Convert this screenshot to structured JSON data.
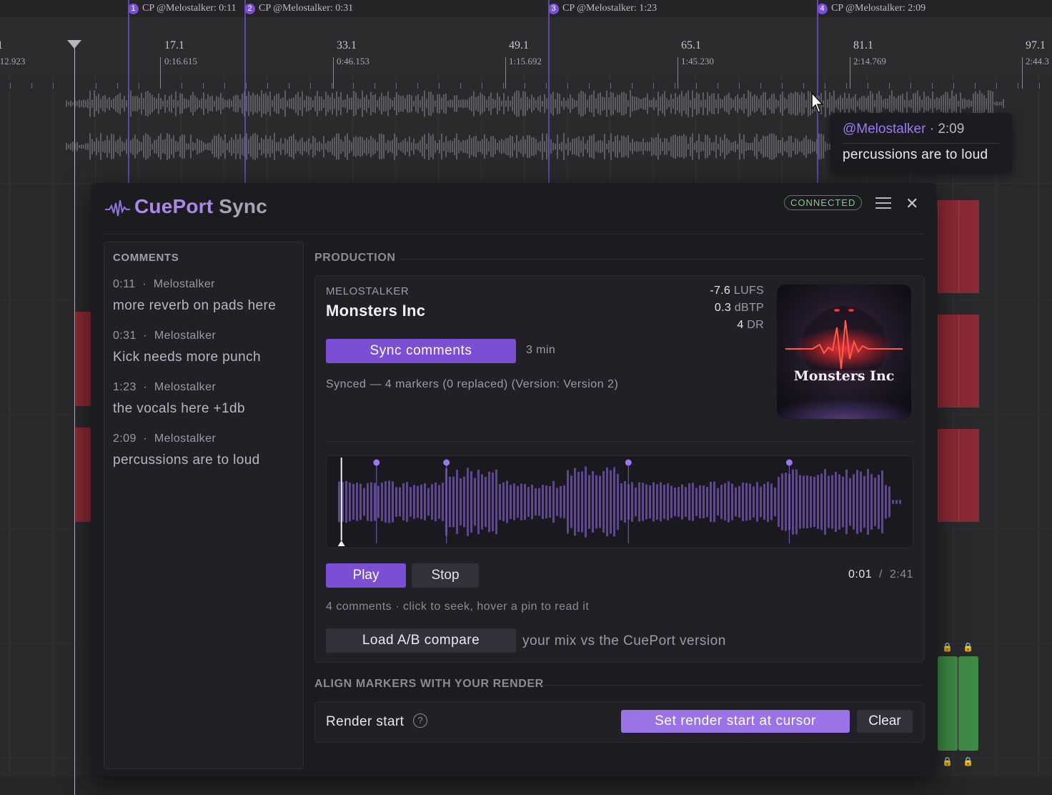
{
  "timeline": {
    "markers": [
      {
        "num": "1",
        "label": "CP @Melostalker: 0:11"
      },
      {
        "num": "2",
        "label": "CP @Melostalker: 0:31"
      },
      {
        "num": "3",
        "label": "CP @Melostalker: 1:23"
      },
      {
        "num": "4",
        "label": "CP @Melostalker: 2:09"
      }
    ],
    "ruler": [
      {
        "bar": "1",
        "time": ":12.923"
      },
      {
        "bar": "17.1",
        "time": "0:16.615"
      },
      {
        "bar": "33.1",
        "time": "0:46.153"
      },
      {
        "bar": "49.1",
        "time": "1:15.692"
      },
      {
        "bar": "65.1",
        "time": "1:45.230"
      },
      {
        "bar": "81.1",
        "time": "2:14.769"
      },
      {
        "bar": "97.1",
        "time": "2:44.3"
      }
    ]
  },
  "tooltip": {
    "user": "@Melostalker",
    "time": "· 2:09",
    "text": "percussions are to loud"
  },
  "plugin": {
    "title_part1": "CuePort",
    "title_part2": "Sync",
    "status": "CONNECTED",
    "accent_color": "#7b4fd4",
    "icons": {
      "menu": "hamburger-menu-icon",
      "close": "close-icon",
      "help": "help-circle-icon",
      "logo": "waveform-logo-icon"
    }
  },
  "comments": {
    "title": "COMMENTS",
    "items": [
      {
        "time": "0:11",
        "sep": "·",
        "author": "Melostalker",
        "text": "more reverb on pads here"
      },
      {
        "time": "0:31",
        "sep": "·",
        "author": "Melostalker",
        "text": "Kick needs more punch"
      },
      {
        "time": "1:23",
        "sep": "·",
        "author": "Melostalker",
        "text": "the vocals here +1db"
      },
      {
        "time": "2:09",
        "sep": "·",
        "author": "Melostalker",
        "text": "percussions are to loud"
      }
    ]
  },
  "production": {
    "section_label": "PRODUCTION",
    "artist": "MELOSTALKER",
    "song": "Monsters Inc",
    "stats": [
      {
        "value": "-7.6",
        "unit": "LUFS"
      },
      {
        "value": "0.3",
        "unit": "dBTP"
      },
      {
        "value": "4",
        "unit": "DR"
      }
    ],
    "album_art_text": "Monsters Inc",
    "sync_button": "Sync comments",
    "sync_age": "3 min",
    "sync_status": "Synced — 4 markers (0 replaced)  (Version: Version 2)",
    "player": {
      "play": "Play",
      "stop": "Stop",
      "current": "0:01",
      "sep": "/",
      "total": "2:41",
      "progress_fraction": 0.006,
      "pin_times_sec": [
        11,
        31,
        83,
        129
      ],
      "duration_sec": 161
    },
    "hint": "4 comments  ·  click to seek, hover a pin to read it",
    "ab_button": "Load A/B compare",
    "ab_desc": "your mix vs the CuePort version"
  },
  "align": {
    "section_label": "ALIGN MARKERS WITH YOUR RENDER",
    "render_label": "Render start",
    "help_glyph": "?",
    "set_button": "Set render start at cursor",
    "clear_button": "Clear"
  }
}
